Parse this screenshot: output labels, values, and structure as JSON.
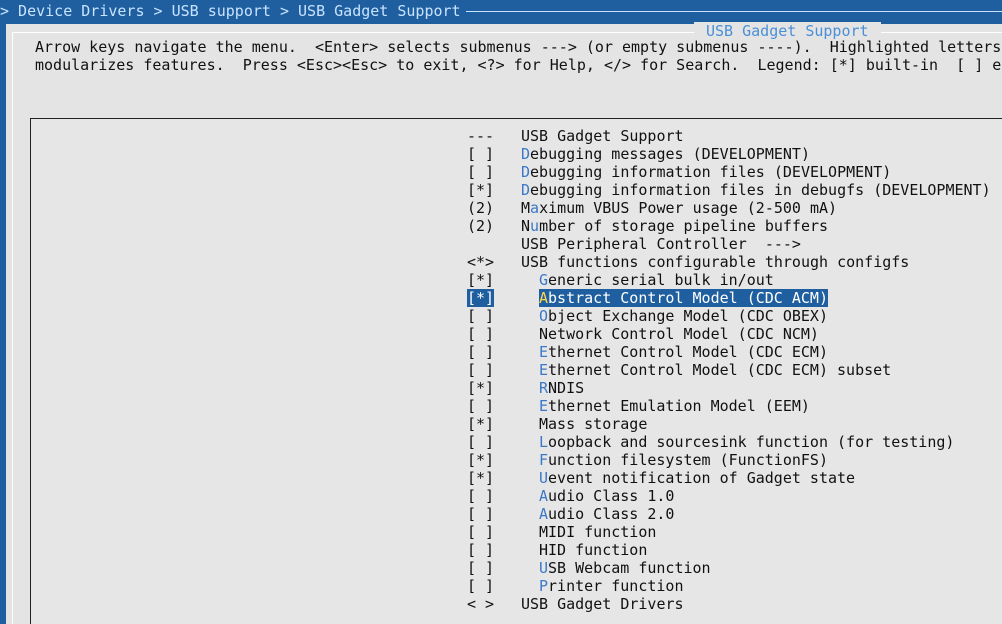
{
  "breadcrumb": "> Device Drivers > USB support > USB Gadget Support",
  "dialog": {
    "title": "USB Gadget Support",
    "help_line1": "Arrow keys navigate the menu.  <Enter> selects submenus ---> (or empty submenus ----).  Highlighted letters",
    "help_line2": "modularizes features.  Press <Esc><Esc> to exit, <?> for Help, </> for Search.  Legend: [*] built-in  [ ] ex"
  },
  "menu": [
    {
      "prefix": "---",
      "hot": "",
      "rest": "USB Gadget Support",
      "indent": false
    },
    {
      "prefix": "[ ]",
      "hot": "D",
      "rest": "ebugging messages (DEVELOPMENT)",
      "indent": false
    },
    {
      "prefix": "[ ]",
      "hot": "D",
      "rest": "ebugging information files (DEVELOPMENT)",
      "indent": false
    },
    {
      "prefix": "[*]",
      "hot": "D",
      "rest": "ebugging information files in debugfs (DEVELOPMENT)",
      "indent": false
    },
    {
      "prefix": "(2)",
      "hot": "",
      "rest": "Maximum VBUS Power usage (2-500 mA)",
      "hot2": "a",
      "indent": false
    },
    {
      "prefix": "(2)",
      "hot": "",
      "rest": "Number of storage pipeline buffers",
      "hot2": "u",
      "indent": false
    },
    {
      "prefix": "",
      "hot": "",
      "rest": "USB Peripheral Controller  --->",
      "indent": false
    },
    {
      "prefix": "<*>",
      "hot": "",
      "rest": "USB functions configurable through configfs",
      "indent": false
    },
    {
      "prefix": "[*]",
      "hot": "G",
      "rest": "eneric serial bulk in/out",
      "indent": true
    },
    {
      "prefix": "[*]",
      "hot": "A",
      "rest": "bstract Control Model (CDC ACM)",
      "indent": true,
      "selected": true
    },
    {
      "prefix": "[ ]",
      "hot": "O",
      "rest": "bject Exchange Model (CDC OBEX)",
      "indent": true
    },
    {
      "prefix": "[ ]",
      "hot": "",
      "rest": "Network Control Model (CDC NCM)",
      "indent": true
    },
    {
      "prefix": "[ ]",
      "hot": "E",
      "rest": "thernet Control Model (CDC ECM)",
      "indent": true
    },
    {
      "prefix": "[ ]",
      "hot": "E",
      "rest": "thernet Control Model (CDC ECM) subset",
      "indent": true
    },
    {
      "prefix": "[*]",
      "hot": "R",
      "rest": "NDIS",
      "indent": true
    },
    {
      "prefix": "[ ]",
      "hot": "E",
      "rest": "thernet Emulation Model (EEM)",
      "indent": true
    },
    {
      "prefix": "[*]",
      "hot": "",
      "rest": "Mass storage",
      "indent": true
    },
    {
      "prefix": "[ ]",
      "hot": "L",
      "rest": "oopback and sourcesink function (for testing)",
      "indent": true
    },
    {
      "prefix": "[*]",
      "hot": "F",
      "rest": "unction filesystem (FunctionFS)",
      "indent": true
    },
    {
      "prefix": "[*]",
      "hot": "U",
      "rest": "event notification of Gadget state",
      "indent": true
    },
    {
      "prefix": "[ ]",
      "hot": "A",
      "rest": "udio Class 1.0",
      "indent": true
    },
    {
      "prefix": "[ ]",
      "hot": "A",
      "rest": "udio Class 2.0",
      "indent": true
    },
    {
      "prefix": "[ ]",
      "hot": "",
      "rest": "MIDI function",
      "indent": true
    },
    {
      "prefix": "[ ]",
      "hot": "",
      "rest": "HID function",
      "indent": true
    },
    {
      "prefix": "[ ]",
      "hot": "U",
      "rest": "SB Webcam function",
      "indent": true
    },
    {
      "prefix": "[ ]",
      "hot": "P",
      "rest": "rinter function",
      "indent": true
    },
    {
      "prefix": "< >",
      "hot": "",
      "rest": "USB Gadget Drivers",
      "indent": false
    }
  ],
  "colors": {
    "background": "#1f5fa0",
    "dialog": "#e4e4e4",
    "hotkey": "#3a78c8",
    "selection": "#1f5fa0",
    "selection_hotkey": "#ffd84a"
  }
}
